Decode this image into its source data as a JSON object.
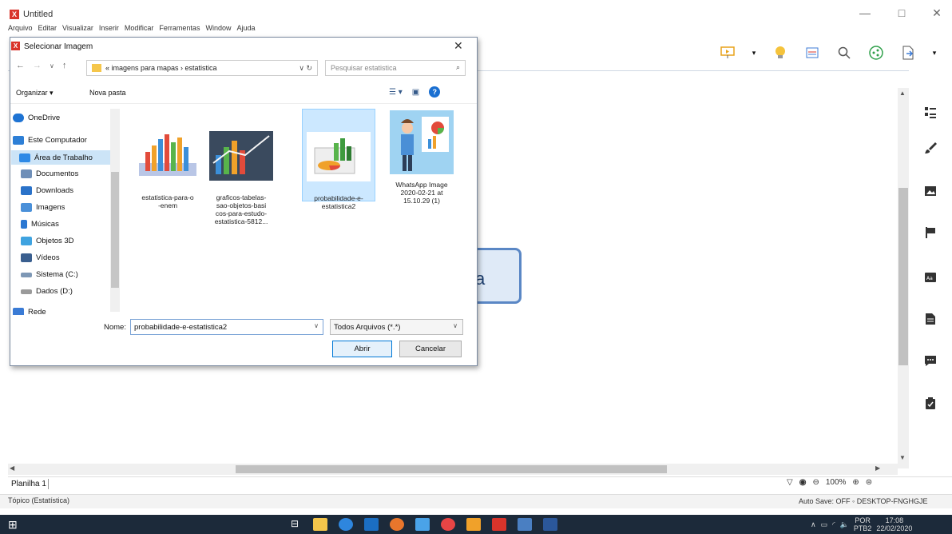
{
  "app": {
    "title": "Untitled",
    "logo": "X",
    "menu": [
      "Arquivo",
      "Editar",
      "Visualizar",
      "Inserir",
      "Modificar",
      "Ferramentas",
      "Window",
      "Ajuda"
    ],
    "window_controls": {
      "minimize": "—",
      "maximize": "□",
      "close": "✕"
    },
    "topic_text": "ca",
    "sheet_tab": "Planilha 1",
    "zoom": "100%",
    "status_left": "Tópico (Estatística)",
    "status_right": "Auto Save: OFF  ◦ DESKTOP-FNGHGJE"
  },
  "toolbar_icons": [
    "presentation-icon",
    "chevron-down-icon",
    "lightbulb-icon",
    "outline-icon",
    "search-icon",
    "share-icon",
    "export-icon",
    "chevron-down-icon"
  ],
  "right_panel_icons": [
    "format-list-icon",
    "brush-icon",
    "image-icon",
    "flag-icon",
    "label-icon",
    "notes-icon",
    "comment-icon",
    "clipboard-icon"
  ],
  "dialog": {
    "title": "Selecionar Imagem",
    "close": "✕",
    "address": "«  imagens para mapas  ›  estatistica",
    "search_placeholder": "Pesquisar estatistica",
    "organize": "Organizar ▾",
    "new_folder": "Nova pasta",
    "nav_items": [
      {
        "label": "OneDrive",
        "icon": "cloud-icon",
        "color": "#1e73d3"
      },
      {
        "label": "Este Computador",
        "icon": "computer-icon",
        "color": "#2d7fd6"
      },
      {
        "label": "Área de Trabalho",
        "icon": "desktop-icon",
        "color": "#2d89e6"
      },
      {
        "label": "Documentos",
        "icon": "document-icon",
        "color": "#6f8fb8"
      },
      {
        "label": "Downloads",
        "icon": "download-icon",
        "color": "#2a72c9"
      },
      {
        "label": "Imagens",
        "icon": "pictures-icon",
        "color": "#4a90d9"
      },
      {
        "label": "Músicas",
        "icon": "music-icon",
        "color": "#2b78d2"
      },
      {
        "label": "Objetos 3D",
        "icon": "3d-icon",
        "color": "#3fa3e0"
      },
      {
        "label": "Vídeos",
        "icon": "video-icon",
        "color": "#3a5f8f"
      },
      {
        "label": "Sistema (C:)",
        "icon": "drive-icon",
        "color": "#7d97b5"
      },
      {
        "label": "Dados (D:)",
        "icon": "drive-icon",
        "color": "#9a9a9a"
      },
      {
        "label": "Rede",
        "icon": "network-icon",
        "color": "#3a7bd5"
      }
    ],
    "files": [
      {
        "name": "estatistica-para-o\n-enem",
        "selected": false
      },
      {
        "name": "graficos-tabelas-\nsao-objetos-basi\ncos-para-estudo-\nestatistica-5812...",
        "selected": false
      },
      {
        "name": "probabilidade-e-\nestatistica2",
        "selected": true
      },
      {
        "name": "WhatsApp Image\n2020-02-21 at\n15.10.29 (1)",
        "selected": false
      }
    ],
    "filename_label": "Nome:",
    "filename_value": "probabilidade-e-estatistica2",
    "filetype": "Todos Arquivos (*.*)",
    "open_label": "Abrir",
    "cancel_label": "Cancelar"
  },
  "tray": {
    "lang": "POR",
    "time": "17:08",
    "sublang": "PTB2",
    "date": "22/02/2020"
  }
}
